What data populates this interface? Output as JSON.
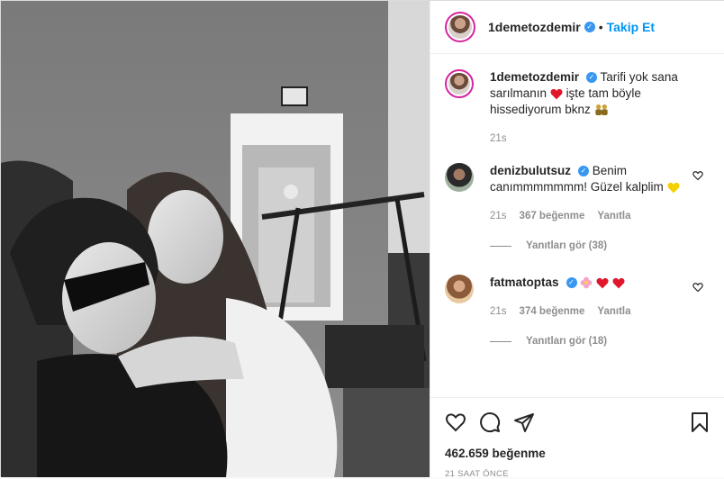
{
  "post": {
    "author": "1demetozdemir",
    "follow_label": "Takip Et",
    "separator": "•",
    "likes_label": "462.659 beğenme",
    "time_label": "21 SAAT ÖNCE"
  },
  "caption": {
    "username": "1demetozdemir",
    "text_part1": "Tarifi yok sana sarılmanın",
    "text_part2": "işte tam böyle hissediyorum bknz",
    "time": "21s"
  },
  "comments": [
    {
      "username": "denizbulutsuz",
      "text": "Benim canımmmmmmm! Güzel kalplim",
      "time": "21s",
      "likes": "367 beğenme",
      "reply_label": "Yanıtla",
      "view_replies": "Yanıtları gör (38)"
    },
    {
      "username": "fatmatoptas",
      "text": "",
      "time": "21s",
      "likes": "374 beğenme",
      "reply_label": "Yanıtla",
      "view_replies": "Yanıtları gör (18)"
    }
  ],
  "colors": {
    "accent_blue": "#0095f6",
    "verified_blue": "#3897f0",
    "heart_red": "#e0162b",
    "heart_yellow": "#f4d000",
    "story_ring": "#d6249f"
  }
}
